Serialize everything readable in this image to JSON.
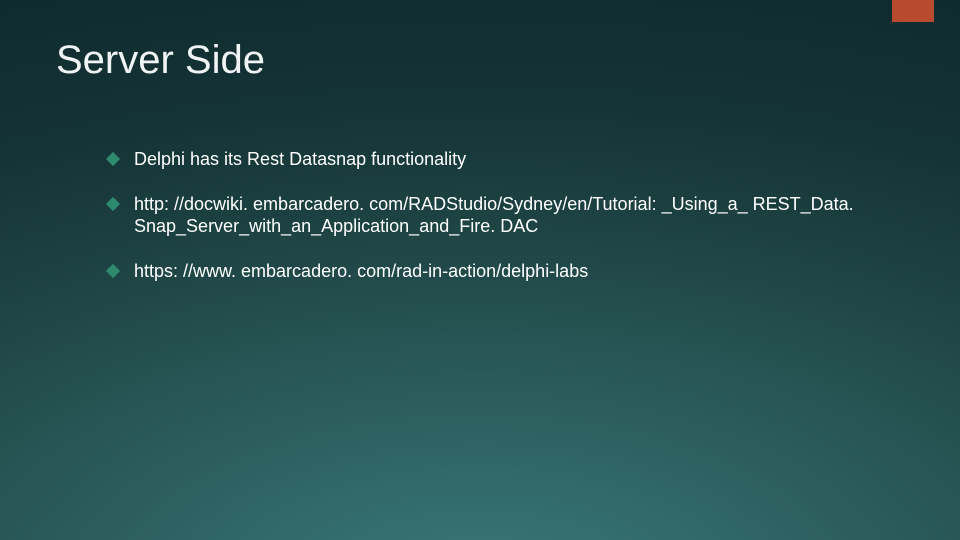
{
  "slide": {
    "title": "Server Side",
    "bullets": [
      "Delphi has its Rest Datasnap functionality",
      "http: //docwiki. embarcadero. com/RADStudio/Sydney/en/Tutorial: _Using_a_ REST_Data. Snap_Server_with_an_Application_and_Fire. DAC",
      "https: //www. embarcadero. com/rad-in-action/delphi-labs"
    ]
  },
  "colors": {
    "accent": "#b84a2f",
    "bullet_diamond": "#2d8a6f"
  }
}
